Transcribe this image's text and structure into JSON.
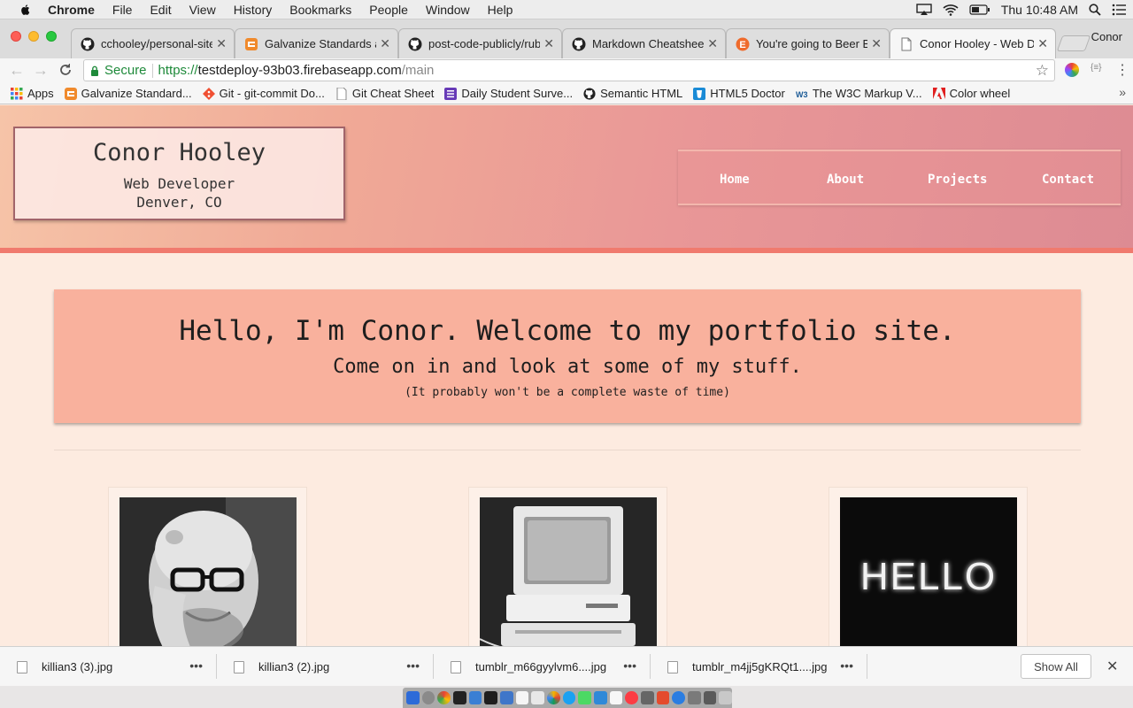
{
  "menubar": {
    "app_name": "Chrome",
    "menus": [
      "File",
      "Edit",
      "View",
      "History",
      "Bookmarks",
      "People",
      "Window",
      "Help"
    ],
    "clock": "Thu 10:48 AM"
  },
  "tabs": [
    {
      "title": "cchooley/personal-site",
      "icon": "github-icon"
    },
    {
      "title": "Galvanize Standards and",
      "icon": "galvanize-icon"
    },
    {
      "title": "post-code-publicly/rub",
      "icon": "github-icon"
    },
    {
      "title": "Markdown Cheatsheet",
      "icon": "github-icon"
    },
    {
      "title": "You're going to Beer Bo",
      "icon": "eventbrite-icon"
    },
    {
      "title": "Conor Hooley - Web De",
      "icon": "page-icon",
      "active": true
    }
  ],
  "profile_name": "Conor",
  "omnibox": {
    "secure_label": "Secure",
    "url_scheme": "https://",
    "url_host": "testdeploy-93b03.firebaseapp.com",
    "url_path": "/main"
  },
  "bookmarks": [
    {
      "label": "Apps",
      "icon": "apps-grid-icon"
    },
    {
      "label": "Galvanize Standard...",
      "icon": "galvanize-icon"
    },
    {
      "label": "Git - git-commit Do...",
      "icon": "git-icon"
    },
    {
      "label": "Git Cheat Sheet",
      "icon": "page-icon"
    },
    {
      "label": "Daily Student Surve...",
      "icon": "forms-icon"
    },
    {
      "label": "Semantic HTML",
      "icon": "github-icon"
    },
    {
      "label": "HTML5 Doctor",
      "icon": "html5doctor-icon"
    },
    {
      "label": "The W3C Markup V...",
      "icon": "w3c-icon"
    },
    {
      "label": "Color wheel",
      "icon": "adobe-icon"
    }
  ],
  "site": {
    "name": "Conor Hooley",
    "role": "Web Developer",
    "location": "Denver, CO",
    "nav": [
      "Home",
      "About",
      "Projects",
      "Contact"
    ],
    "hero_heading": "Hello, I'm Conor. Welcome to my portfolio site.",
    "hero_sub": "Come on in and look at some of my stuff.",
    "hero_small": "(It probably won't be a complete waste of time)",
    "cards": [
      {
        "image": "portrait-photo"
      },
      {
        "image": "vintage-computer-photo"
      },
      {
        "image": "hello-neon-photo",
        "text": "HELLO"
      }
    ]
  },
  "downloads": {
    "files": [
      "killian3 (3).jpg",
      "killian3 (2).jpg",
      "tumblr_m66gyylvm6....jpg",
      "tumblr_m4jj5gKRQt1....jpg"
    ],
    "show_all_label": "Show All"
  },
  "colors": {
    "header_accent": "#f07a6e",
    "hero_bg": "#f9b19d",
    "page_bg": "#fdebe0",
    "secure_green": "#1e8a3a"
  }
}
